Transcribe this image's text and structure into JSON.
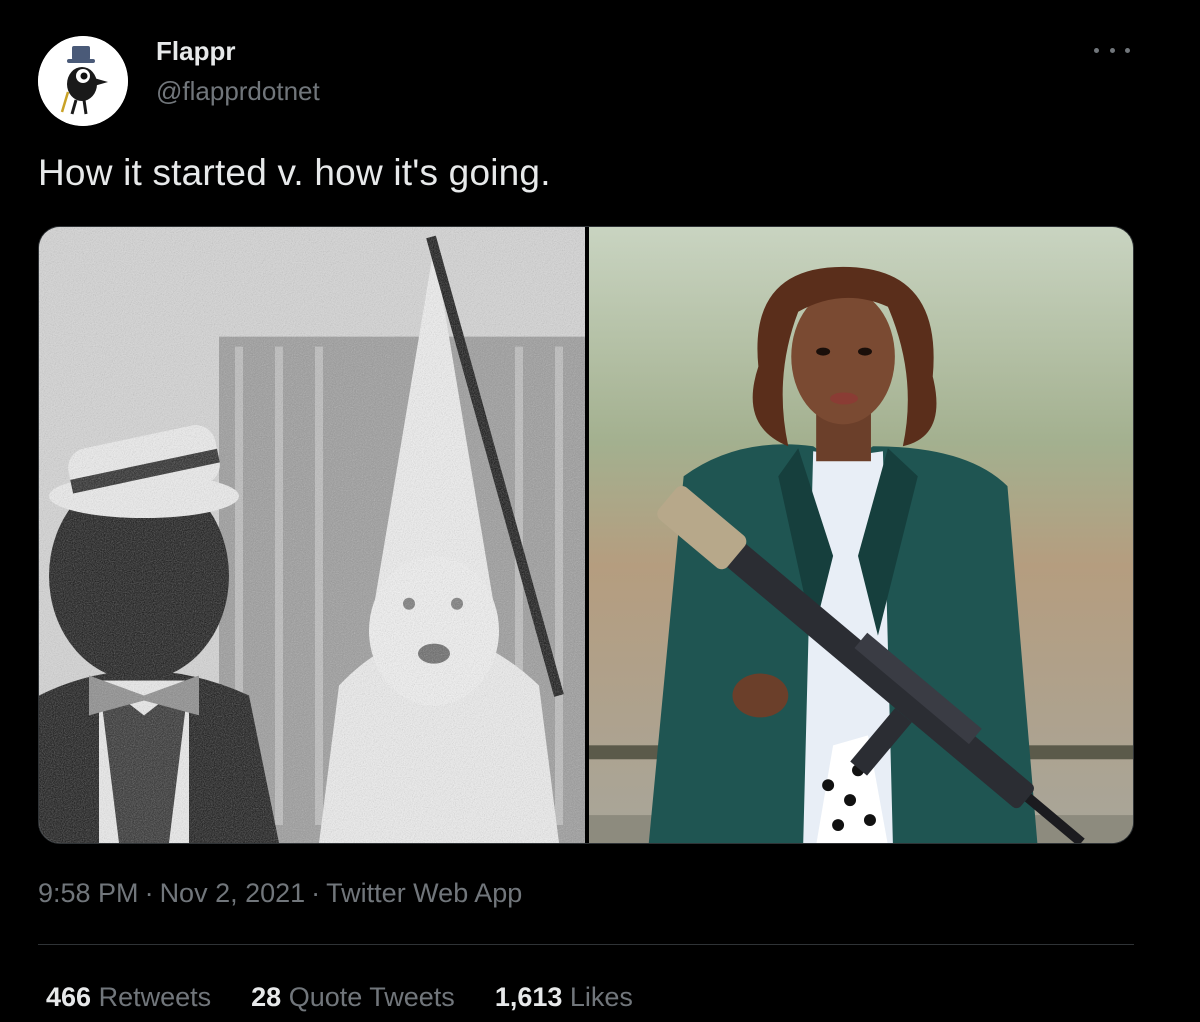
{
  "author": {
    "display_name": "Flappr",
    "handle": "@flapprdotnet",
    "avatar_icon": "crow-with-top-hat-icon"
  },
  "more_icon": "ellipsis-icon",
  "tweet": {
    "text": "How it started v. how it's going.",
    "media": [
      {
        "name": "left-photo",
        "desc_icon": "black-and-white-yearbook-photo"
      },
      {
        "name": "right-photo",
        "desc_icon": "color-portrait-photo"
      }
    ]
  },
  "meta": {
    "time": "9:58 PM",
    "separator": "·",
    "date": "Nov 2, 2021",
    "source": "Twitter Web App"
  },
  "stats": {
    "retweets_count": "466",
    "retweets_label": "Retweets",
    "quotes_count": "28",
    "quotes_label": "Quote Tweets",
    "likes_count": "1,613",
    "likes_label": "Likes"
  },
  "colors": {
    "background": "#000000",
    "primary_text": "#e7e9ea",
    "secondary_text": "#71767b",
    "border": "#2f3336"
  }
}
